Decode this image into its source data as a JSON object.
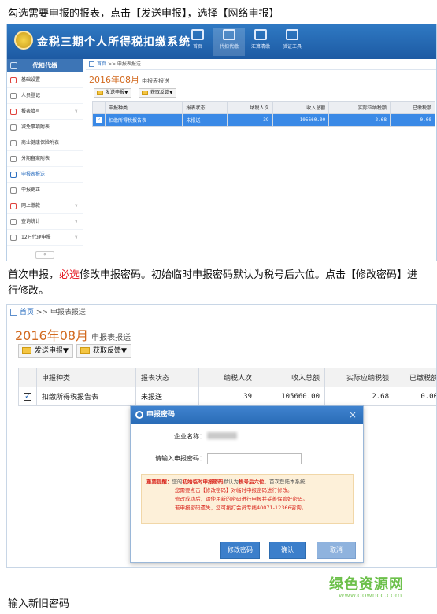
{
  "intro_text": "勾选需要申报的报表，点击【发送申报】，选择【网络申报】",
  "app": {
    "title": "金税三期个人所得税扣缴系统",
    "nav": [
      {
        "label": "首页"
      },
      {
        "label": "代扣代缴"
      },
      {
        "label": "汇算清缴"
      },
      {
        "label": "验证工具"
      }
    ]
  },
  "sidebar": {
    "header": "代扣代缴",
    "items": [
      {
        "label": "基础设置",
        "icon": "target-icon"
      },
      {
        "label": "人员登记",
        "icon": "person-icon"
      },
      {
        "label": "报表填写",
        "icon": "edit-icon",
        "chevron": "∨"
      },
      {
        "label": "减免事项附表",
        "icon": "form-icon"
      },
      {
        "label": "商业健康保险附表",
        "icon": "grid-icon"
      },
      {
        "label": "分期备案附表",
        "icon": "grid-icon"
      },
      {
        "label": "申报表报送",
        "icon": "send-icon"
      },
      {
        "label": "申报更正",
        "icon": "pen-icon"
      },
      {
        "label": "网上缴款",
        "icon": "pay-icon",
        "chevron": "∨"
      },
      {
        "label": "查询统计",
        "icon": "search-icon",
        "chevron": "∨"
      },
      {
        "label": "12万代理申报",
        "icon": "grid-icon",
        "chevron": "∨"
      }
    ],
    "collapse": "«"
  },
  "breadcrumb": {
    "home": "首页",
    "sep": ">>",
    "current": "申报表报送"
  },
  "period": {
    "year_month": "2016年08月",
    "suffix": "申报表报送"
  },
  "toolbar": {
    "send": "发送申报▼",
    "feedback": "获取反馈▼"
  },
  "table": {
    "headers": [
      "申报种类",
      "报表状态",
      "纳税人次",
      "收入总额",
      "实际应纳税额",
      "已缴税额"
    ],
    "rows": [
      {
        "checked": "✓",
        "type": "扣缴所得税报告表",
        "status": "未报送",
        "count": "39",
        "income": "105660.00",
        "tax_due": "2.68",
        "paid": "0.00"
      }
    ]
  },
  "middle_text": {
    "a": "首次申报，",
    "b": "必选",
    "c": "修改申报密码。初始临时申报密码默认为税号后六位。点击【修改密码】进",
    "d": "行修改。"
  },
  "dialog": {
    "title": "申报密码",
    "close": "×",
    "company_label": "企业名称：",
    "password_label": "请输入申报密码：",
    "tip_label": "重要提醒：",
    "tip_1": "您的",
    "tip_2": "初始临时申报密码",
    "tip_3": "默认为",
    "tip_4": "税号后六位",
    "tip_5": "，首次登陆本系统",
    "tip_line2": "您需要点击【修改密码】对临时申报密码进行修改。",
    "tip_line3": "修改成功后，请使用新的密码进行申报并妥善保管好密码。",
    "tip_line4": "若申报密码遗失，您可拨打会员专线40071-12366咨询。",
    "buttons": {
      "change": "修改密码",
      "confirm": "确认",
      "cancel": "取消"
    }
  },
  "footer_text": "输入新旧密码",
  "watermark": {
    "name": "绿色资源网",
    "url": "www.downcc.com"
  },
  "colors": {
    "brand_blue": "#1d5aa3",
    "selected_row": "#3a89e6",
    "period": "#d2691e",
    "warning_red": "#d9281f"
  }
}
